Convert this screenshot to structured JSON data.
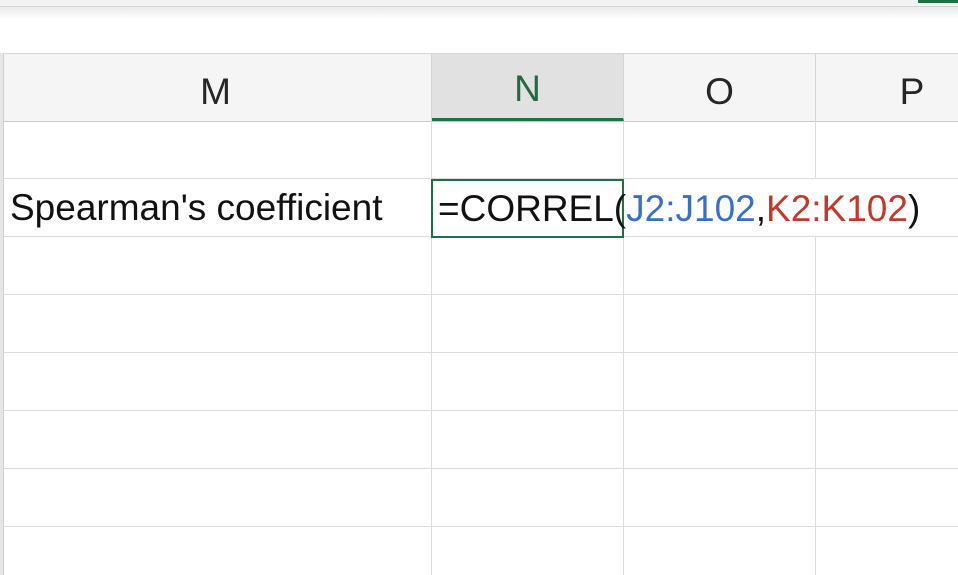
{
  "columns": [
    {
      "letter": "M"
    },
    {
      "letter": "N"
    },
    {
      "letter": "O"
    },
    {
      "letter": "P"
    }
  ],
  "selected_column": "N",
  "cells": {
    "M2": "Spearman's coefficient"
  },
  "formula": {
    "prefix": "=CORREL(",
    "range1": "J2:J102",
    "separator": ",",
    "range2": "K2:K102",
    "suffix": ")"
  },
  "colors": {
    "accent": "#1e7145",
    "range1_color": "#3a6fc4",
    "range2_color": "#c0392b"
  }
}
